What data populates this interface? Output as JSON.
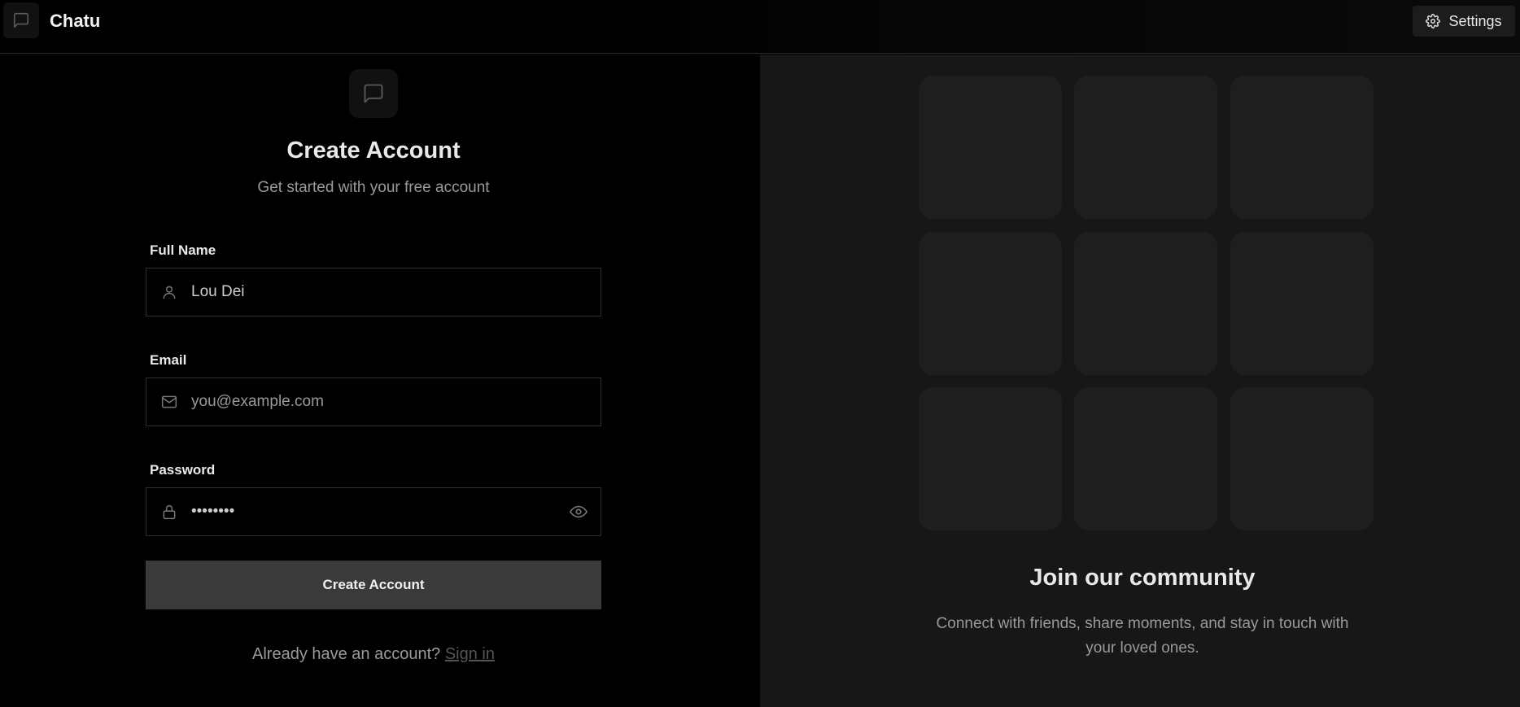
{
  "app": {
    "title": "Chatu",
    "settings_label": "Settings"
  },
  "form": {
    "heading": "Create Account",
    "subheading": "Get started with your free account",
    "full_name": {
      "label": "Full Name",
      "value": "Lou Dei"
    },
    "email": {
      "label": "Email",
      "placeholder": "you@example.com",
      "value": ""
    },
    "password": {
      "label": "Password",
      "value": "........"
    },
    "submit_label": "Create Account",
    "signin_prompt": "Already have an account?",
    "signin_link": "Sign in"
  },
  "community": {
    "title": "Join our community",
    "text": "Connect with friends, share moments, and stay in touch with your loved ones."
  },
  "icons": {
    "logo": "message-square-icon",
    "settings": "gear-icon",
    "user": "user-icon",
    "mail": "mail-icon",
    "lock": "lock-icon",
    "eye": "eye-icon"
  },
  "colors": {
    "background": "#000000",
    "panel": "#171717",
    "tile": "#1e1e1e",
    "button": "#3a3a3a",
    "muted_text": "#9a9a9a"
  }
}
